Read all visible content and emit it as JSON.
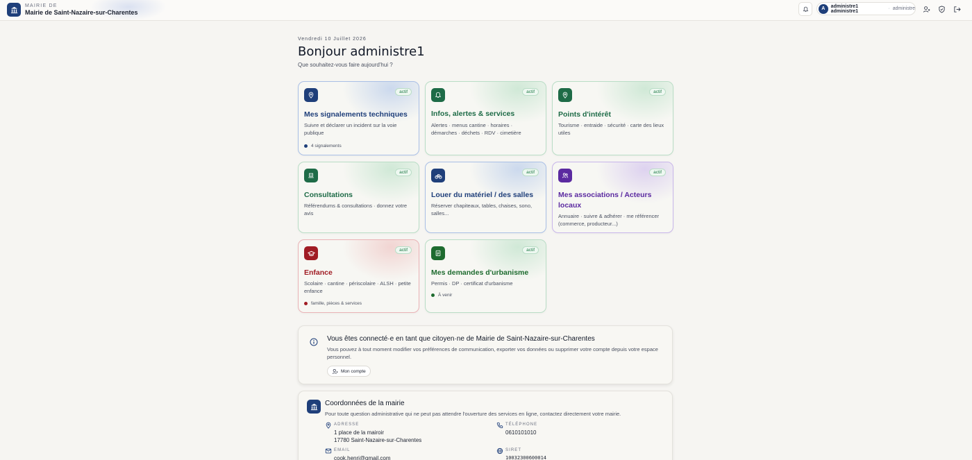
{
  "header": {
    "kicker": "MAIRIE DE",
    "name": "Mairie de Saint-Nazaire-sur-Charentes",
    "user_initial": "A",
    "user_name": "administre1 administre1",
    "user_separator": "·",
    "user_role": "administre"
  },
  "main": {
    "date": "Vendredi 10 Juillet 2026",
    "greeting": "Bonjour administre1",
    "subtitle": "Que souhaitez-vous faire aujourd'hui ?"
  },
  "cards": [
    {
      "title": "Mes signalements techniques",
      "desc": "Suivre et déclarer un incident sur la voie publique",
      "badge": "actif",
      "foot": "4 signalements",
      "color": "#1f3f7a",
      "icon": "map-pin-icon"
    },
    {
      "title": "Infos, alertes & services",
      "desc": "Alertes · menus cantine · horaires · démarches · déchets · RDV · cimetière",
      "badge": "actif",
      "foot": "",
      "color": "#1e6b47",
      "icon": "bell-icon"
    },
    {
      "title": "Points d'intérêt",
      "desc": "Tourisme · entraide · sécurité · carte des lieux utiles",
      "badge": "actif",
      "foot": "",
      "color": "#1e6b47",
      "icon": "map-pin-icon"
    },
    {
      "title": "Consultations",
      "desc": "Référendums & consultations · donnez votre avis",
      "badge": "actif",
      "foot": "",
      "color": "#1e6b47",
      "icon": "ballot-icon"
    },
    {
      "title": "Louer du matériel / des salles",
      "desc": "Réserver chapiteaux, tables, chaises, sono, salles...",
      "badge": "actif",
      "foot": "",
      "color": "#1f3f7a",
      "icon": "bicycle-icon"
    },
    {
      "title": "Mes associations / Acteurs locaux",
      "desc": "Annuaire · suivre & adhérer · me référencer (commerce, producteur...)",
      "badge": "actif",
      "foot": "",
      "color": "#5b2aa0",
      "icon": "users-icon"
    },
    {
      "title": "Enfance",
      "desc": "Scolaire · cantine · périscolaire · ALSH · petite enfance",
      "badge": "actif",
      "foot": "famille, pièces & services",
      "color": "#a01c24",
      "icon": "graduation-cap-icon"
    },
    {
      "title": "Mes demandes d'urbanisme",
      "desc": "Permis · DP · certificat d'urbanisme",
      "badge": "actif",
      "foot": "À venir",
      "color": "#1e6b2f",
      "icon": "document-icon"
    }
  ],
  "info": {
    "title": "Vous êtes connecté·e en tant que citoyen·ne de Mairie de Saint-Nazaire-sur-Charentes",
    "desc": "Vous pouvez à tout moment modifier vos préférences de communication, exporter vos données ou supprimer votre compte depuis votre espace personnel.",
    "button": "Mon compte"
  },
  "contact": {
    "title": "Coordonnées de la mairie",
    "desc": "Pour toute question administrative qui ne peut pas attendre l'ouverture des services en ligne, contactez directement votre mairie.",
    "address_label": "ADRESSE",
    "address_line1": "1 place de la mairoir",
    "address_line2": "17780 Saint-Nazaire-sur-Charentes",
    "phone_label": "TÉLÉPHONE",
    "phone": "0610101010",
    "email_label": "EMAIL",
    "email": "cook.henri@gmail.com",
    "siret_label": "SIRET",
    "siret": "10032300600014"
  }
}
